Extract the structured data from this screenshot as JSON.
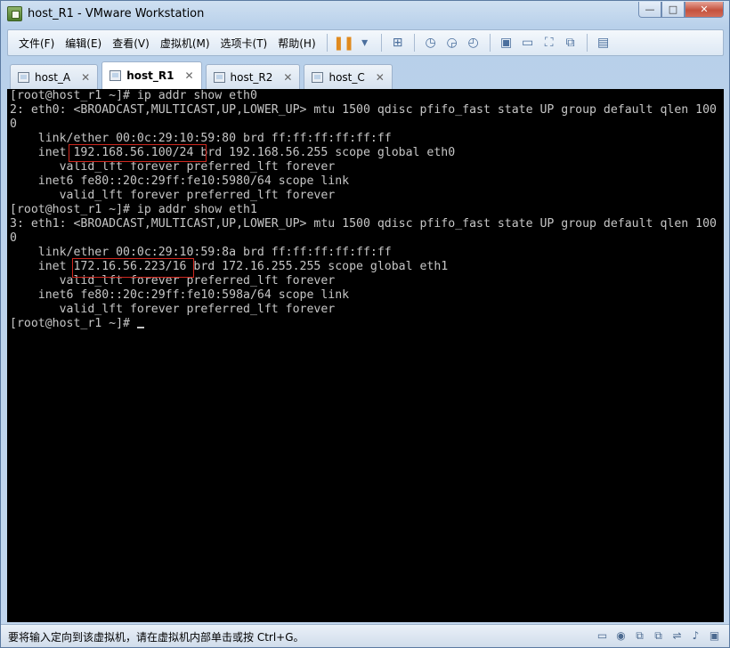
{
  "window": {
    "title": "host_R1 - VMware Workstation",
    "buttons": {
      "minimize": "—",
      "maximize": "□",
      "close": "✕"
    }
  },
  "menu": [
    {
      "id": "file",
      "label": "文件(F)"
    },
    {
      "id": "edit",
      "label": "编辑(E)"
    },
    {
      "id": "view",
      "label": "查看(V)"
    },
    {
      "id": "vm",
      "label": "虚拟机(M)"
    },
    {
      "id": "tabs",
      "label": "选项卡(T)"
    },
    {
      "id": "help",
      "label": "帮助(H)"
    }
  ],
  "toolbar_icons": {
    "pause": "❚❚",
    "dropdown": "▾",
    "send_keys": "⊞",
    "snapshot": "◷",
    "revert": "◶",
    "manage": "◴",
    "sidebar": "▣",
    "console_view": "▭",
    "fullscreen": "⛶",
    "unity": "⧉",
    "library": "▤"
  },
  "tabs": [
    {
      "label": "host_A",
      "active": false
    },
    {
      "label": "host_R1",
      "active": true
    },
    {
      "label": "host_R2",
      "active": false
    },
    {
      "label": "host_C",
      "active": false
    }
  ],
  "tab_close_glyph": "✕",
  "console": {
    "lines": [
      "[root@host_r1 ~]# ip addr show eth0",
      "2: eth0: <BROADCAST,MULTICAST,UP,LOWER_UP> mtu 1500 qdisc pfifo_fast state UP group default qlen 100",
      "0",
      "    link/ether 00:0c:29:10:59:80 brd ff:ff:ff:ff:ff:ff",
      "    inet 192.168.56.100/24 brd 192.168.56.255 scope global eth0",
      "       valid_lft forever preferred_lft forever",
      "    inet6 fe80::20c:29ff:fe10:5980/64 scope link",
      "       valid_lft forever preferred_lft forever",
      "[root@host_r1 ~]# ip addr show eth1",
      "3: eth1: <BROADCAST,MULTICAST,UP,LOWER_UP> mtu 1500 qdisc pfifo_fast state UP group default qlen 100",
      "0",
      "    link/ether 00:0c:29:10:59:8a brd ff:ff:ff:ff:ff:ff",
      "    inet 172.16.56.223/16 brd 172.16.255.255 scope global eth1",
      "       valid_lft forever preferred_lft forever",
      "    inet6 fe80::20c:29ff:fe10:598a/64 scope link",
      "       valid_lft forever preferred_lft forever",
      "[root@host_r1 ~]# "
    ],
    "background": "#000000",
    "text_color": "#c6c6c6",
    "highlight_color": "#d0281f"
  },
  "status": {
    "text": "要将输入定向到该虚拟机，请在虚拟机内部单击或按 Ctrl+G。",
    "icons": [
      "hdd-icon",
      "cd-icon",
      "network-icon",
      "network-icon-2",
      "usb-icon",
      "sound-icon",
      "display-icon"
    ]
  }
}
